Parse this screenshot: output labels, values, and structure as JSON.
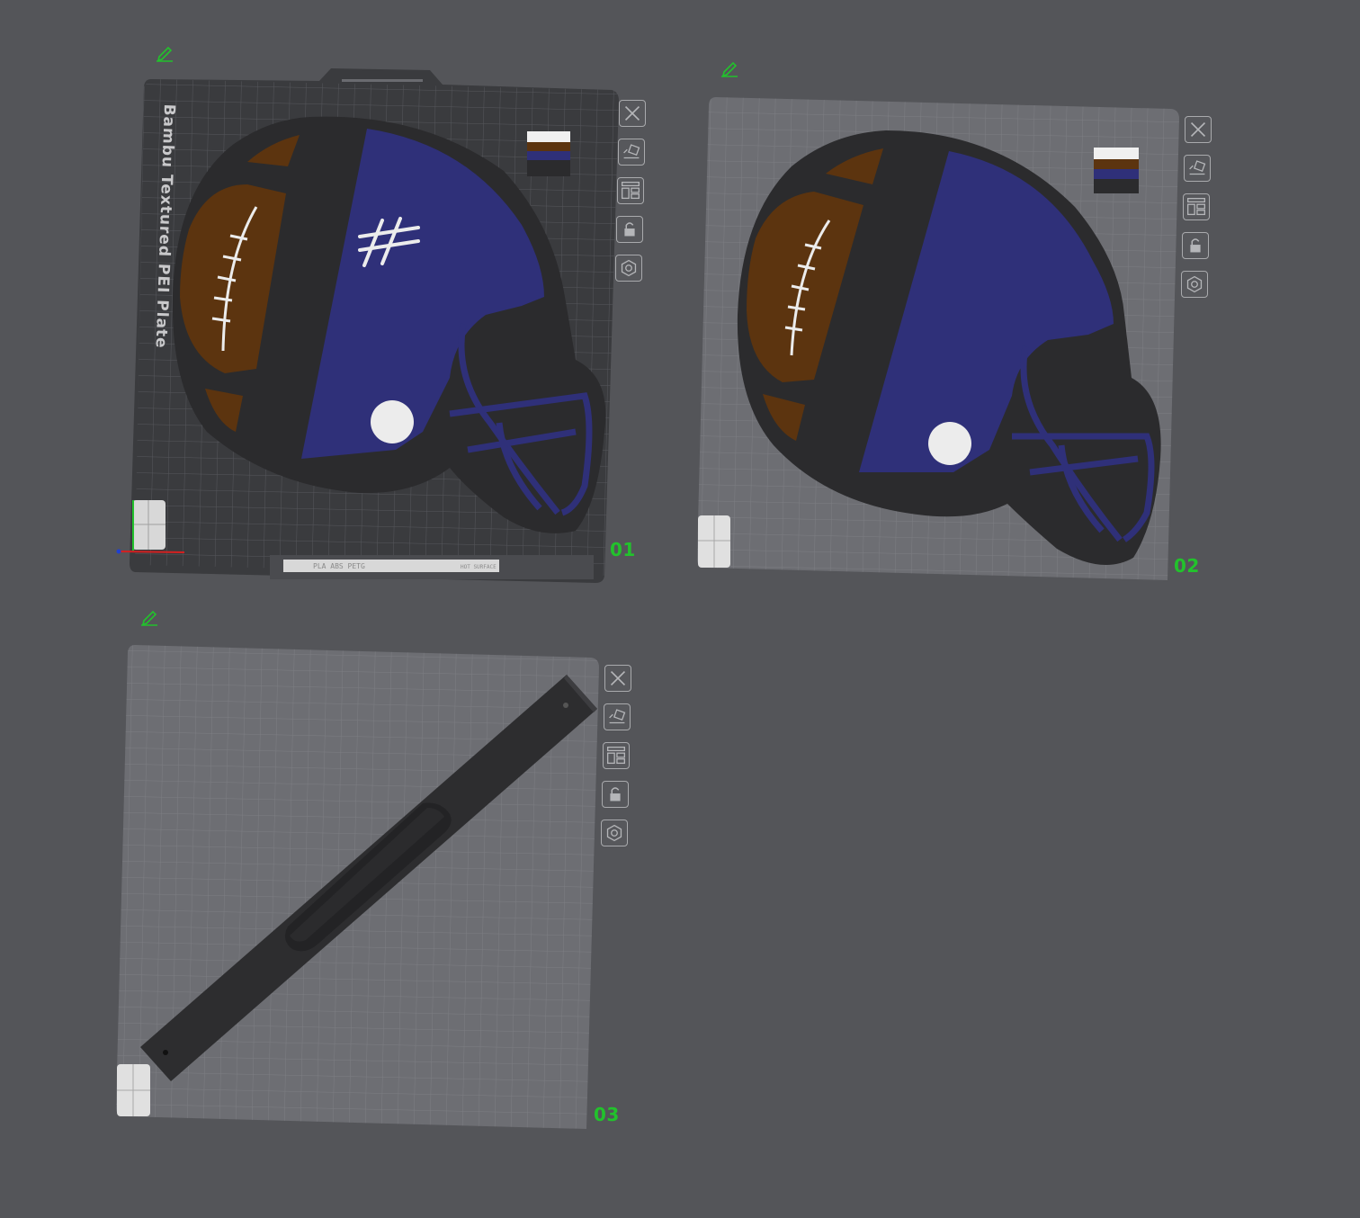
{
  "plates": [
    {
      "id": "01",
      "number_label": "01",
      "bed_type_text": "Bambu Textured PEI Plate",
      "footer_text": "PLA ABS PETG",
      "footer_text2": "HOT SURFACE"
    },
    {
      "id": "02",
      "number_label": "02"
    },
    {
      "id": "03",
      "number_label": "03"
    }
  ],
  "toolbar_icons": [
    "close-icon",
    "auto-orient-icon",
    "arrange-icon",
    "lock-icon",
    "settings-icon"
  ],
  "colors": {
    "background": "#545559",
    "plate_dark": "#3a3b3e",
    "plate_light": "#6e6f74",
    "grid": "#7e7f84",
    "helmet_black": "#2e2e2e",
    "helmet_blue": "#2f3079",
    "football_brown": "#5e3510",
    "white": "#ececec",
    "plate_number_green": "#22c22c"
  }
}
